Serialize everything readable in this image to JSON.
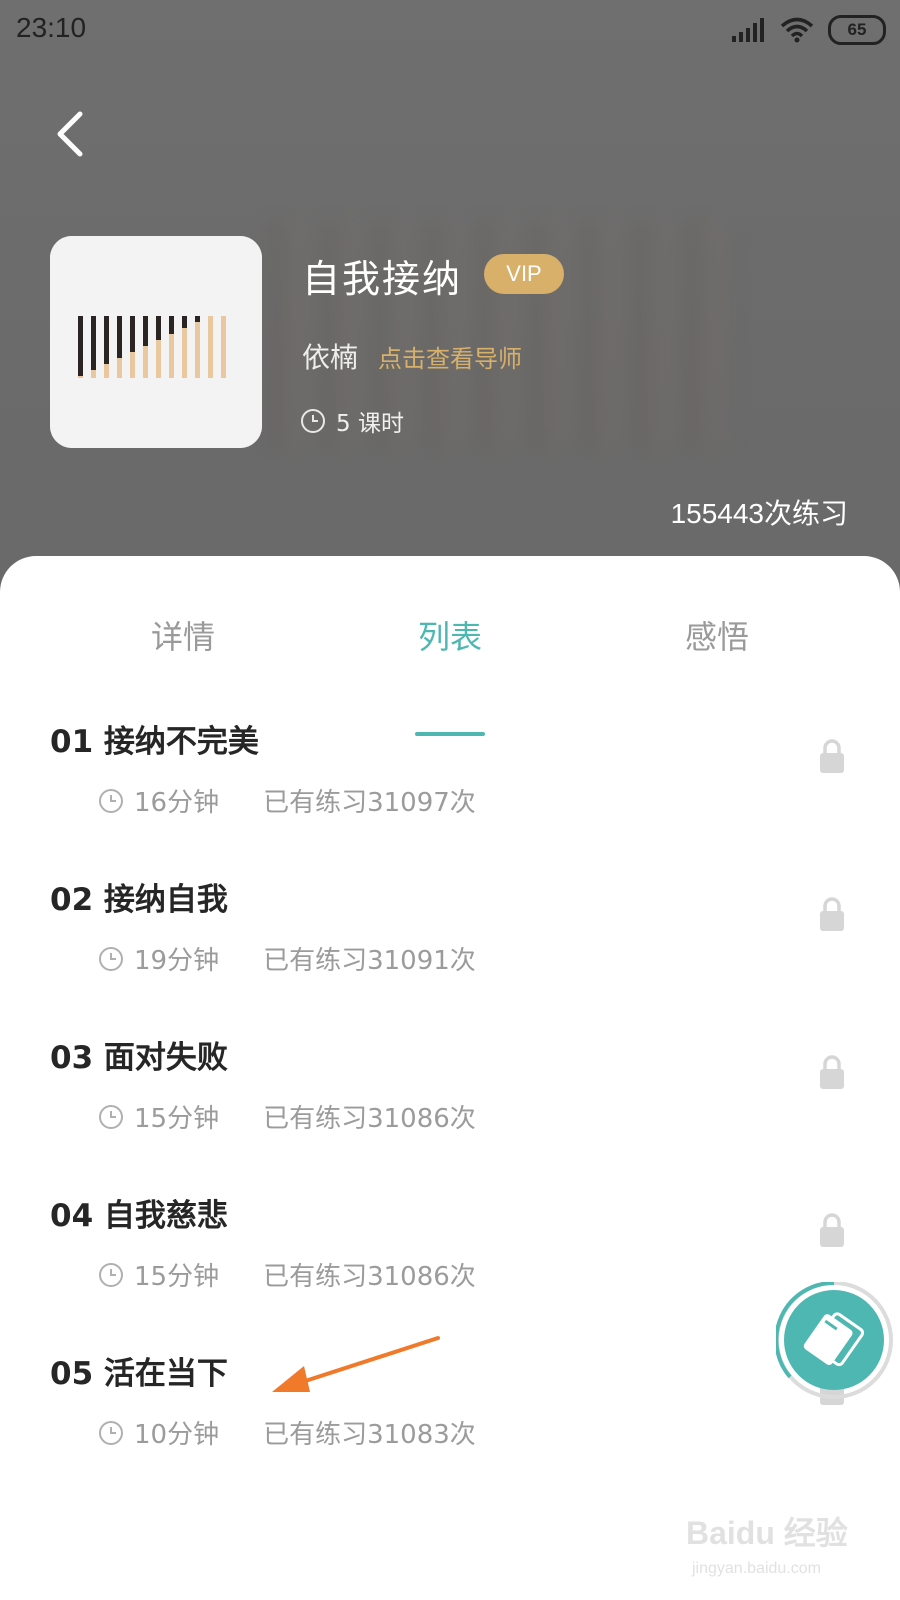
{
  "status_bar": {
    "time": "23:10",
    "battery": "65"
  },
  "course": {
    "title": "自我接纳",
    "vip_label": "VIP",
    "teacher": "依楠",
    "teacher_link": "点击查看导师",
    "lessons": "5 课时",
    "practice_total": "155443次练习"
  },
  "tabs": [
    {
      "label": "详情",
      "active": false
    },
    {
      "label": "列表",
      "active": true
    },
    {
      "label": "感悟",
      "active": false
    }
  ],
  "lessons": [
    {
      "title": "01 接纳不完美",
      "duration": "16分钟",
      "count": "已有练习31097次",
      "locked": true
    },
    {
      "title": "02 接纳自我",
      "duration": "19分钟",
      "count": "已有练习31091次",
      "locked": true
    },
    {
      "title": "03 面对失败",
      "duration": "15分钟",
      "count": "已有练习31086次",
      "locked": true
    },
    {
      "title": "04 自我慈悲",
      "duration": "15分钟",
      "count": "已有练习31086次",
      "locked": true
    },
    {
      "title": "05 活在当下",
      "duration": "10分钟",
      "count": "已有练习31083次",
      "locked": true
    }
  ],
  "colors": {
    "accent": "#4fb7b2",
    "gold": "#d8b06a",
    "annotation": "#f07a2a"
  },
  "icons": {
    "back": "chevron-left-icon",
    "clock": "clock-icon",
    "lock": "lock-icon",
    "player": "player-card-icon"
  },
  "watermark": {
    "main": "Baidu 经验",
    "sub": "jingyan.baidu.com"
  }
}
